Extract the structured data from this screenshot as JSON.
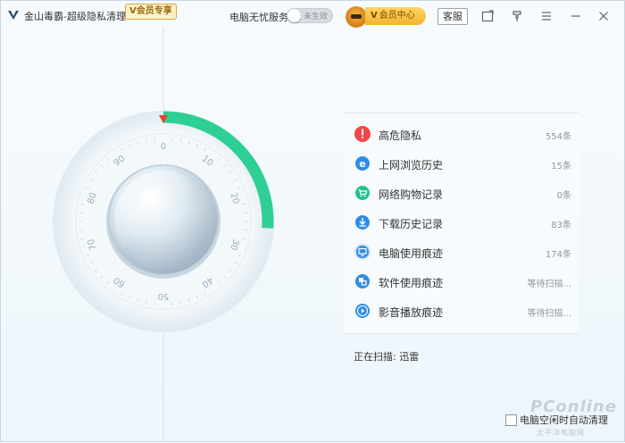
{
  "app": {
    "title": "金山毒霸-超级隐私清理",
    "vip_badge": "V会员专享"
  },
  "toolbar": {
    "service_label": "电脑无忧服务",
    "toggle_text": "未生效",
    "toggle_on": false,
    "member_v": "V",
    "member_label": "会员中心",
    "service_button": "客服"
  },
  "dial": {
    "ticks": [
      "0",
      "10",
      "20",
      "30",
      "40",
      "50",
      "60",
      "70",
      "80",
      "90"
    ],
    "progress_fraction": 0.26,
    "accent": "#2ecf94"
  },
  "items": [
    {
      "label": "高危隐私",
      "count": "554条",
      "icon": "warning-icon",
      "color": "#f04848"
    },
    {
      "label": "上网浏览历史",
      "count": "15条",
      "icon": "browser-icon",
      "color": "#2d8ee6"
    },
    {
      "label": "网络购物记录",
      "count": "0条",
      "icon": "cart-icon",
      "color": "#20c38a"
    },
    {
      "label": "下载历史记录",
      "count": "83条",
      "icon": "download-icon",
      "color": "#2d8ee6"
    },
    {
      "label": "电脑使用痕迹",
      "count": "174条",
      "icon": "computer-icon",
      "color": "#2d8ee6"
    },
    {
      "label": "软件使用痕迹",
      "count": "等待扫描...",
      "icon": "software-icon",
      "color": "#2d8ee6"
    },
    {
      "label": "影音播放痕迹",
      "count": "等待扫描...",
      "icon": "play-icon",
      "color": "#2d8ee6"
    }
  ],
  "status": {
    "scanning": "正在扫描:  迅雷"
  },
  "footer": {
    "checkbox_label": "电脑空闲时自动清理",
    "watermark": "PConline",
    "watermark_sub": "太平洋电脑网"
  }
}
